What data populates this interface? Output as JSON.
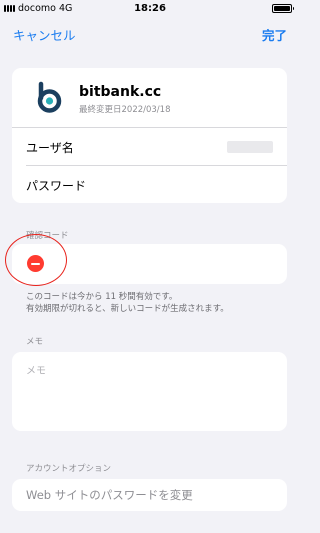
{
  "status_bar": {
    "carrier": "docomo",
    "network": "4G",
    "time": "18:26"
  },
  "nav": {
    "cancel": "キャンセル",
    "done": "完了"
  },
  "site": {
    "title": "bitbank.cc",
    "subtitle": "最終変更日2022/03/18"
  },
  "fields": {
    "username_label": "ユーザ名",
    "password_label": "パスワード"
  },
  "verification": {
    "section_label": "確認コード",
    "note_line1": "このコードは今から 11 秒間有効です。",
    "note_line2": "有効期限が切れると、新しいコードが生成されます。"
  },
  "memo": {
    "section_label": "メモ",
    "placeholder": "メモ"
  },
  "account_options": {
    "section_label": "アカウントオプション",
    "change_password": "Web サイトのパスワードを変更"
  },
  "colors": {
    "accent": "#1a7cf0",
    "delete": "#ff3b30",
    "annotation": "#e8221b"
  }
}
